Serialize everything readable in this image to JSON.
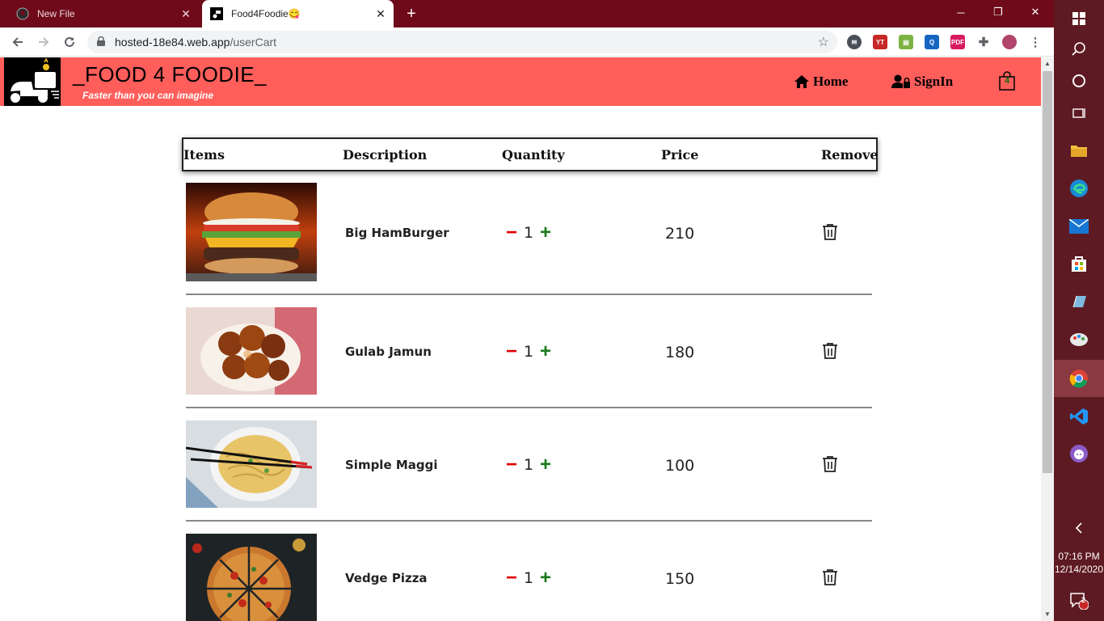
{
  "browser": {
    "tabs": [
      {
        "title": "New File",
        "active": false
      },
      {
        "title": "Food4Foodie😋",
        "active": true
      }
    ],
    "url_host": "hosted-18e84.web.app",
    "url_path": "/userCart"
  },
  "site": {
    "brand_title": "_FOOD 4 FOODIE_",
    "tagline": "Faster than you can imagine",
    "nav": {
      "home": "Home",
      "signin": "SignIn"
    },
    "cart_count": "4",
    "accent_color": "#ff5e5b"
  },
  "cart": {
    "headers": [
      "Items",
      "Description",
      "Quantity",
      "Price",
      "Remove"
    ],
    "items": [
      {
        "name": "Big HamBurger",
        "qty": "1",
        "price": "210",
        "image": "burger"
      },
      {
        "name": "Gulab Jamun",
        "qty": "1",
        "price": "180",
        "image": "gulab-jamun"
      },
      {
        "name": "Simple Maggi",
        "qty": "1",
        "price": "100",
        "image": "noodles"
      },
      {
        "name": "Vedge Pizza",
        "qty": "1",
        "price": "150",
        "image": "pizza"
      }
    ],
    "minus_symbol": "−",
    "plus_symbol": "+"
  },
  "taskbar": {
    "time": "07:16 PM",
    "date": "12/14/2020",
    "notification_count": "2"
  }
}
